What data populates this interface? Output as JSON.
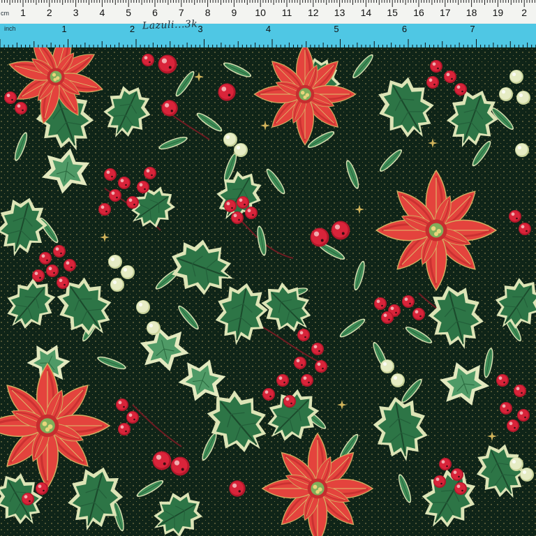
{
  "ruler": {
    "cm_unit": "cm",
    "inch_unit": "inch",
    "cm_numbers": [
      "1",
      "2",
      "3",
      "4",
      "5",
      "6",
      "7",
      "8",
      "9",
      "10",
      "11",
      "12",
      "13",
      "14",
      "15",
      "16",
      "17",
      "18",
      "19",
      "2"
    ],
    "inch_numbers": [
      "1",
      "2",
      "3",
      "4",
      "5",
      "6",
      "7"
    ],
    "handwriting": "Lazuli...3k"
  },
  "fabric": {
    "background_color": "#0f2418",
    "motifs": [
      "poinsettia",
      "holly-leaf",
      "red-berry",
      "mistletoe-berry",
      "ivy-leaf",
      "olive-leaf",
      "gold-star"
    ],
    "colors": {
      "poinsettia_red": "#e23c3a",
      "poinsettia_dark": "#b52027",
      "holly_green": "#2f7a48",
      "holly_edge": "#d9e2b0",
      "berry_red": "#c8192c",
      "mistletoe": "#dfe6b3",
      "gold": "#d2b45c"
    }
  }
}
